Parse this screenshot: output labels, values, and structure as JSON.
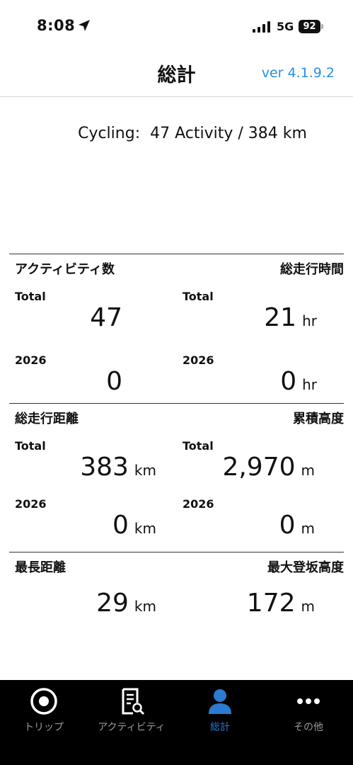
{
  "status_bar": {
    "time": "8:08",
    "network": "5G",
    "battery": "92"
  },
  "header": {
    "title": "総計",
    "version": "ver 4.1.9.2"
  },
  "summary": "Cycling:  47 Activity / 384 km",
  "sections": [
    {
      "left_title": "アクティビティ数",
      "right_title": "総走行時間",
      "rows": [
        {
          "left": {
            "label": "Total",
            "value": "47",
            "unit": ""
          },
          "right": {
            "label": "Total",
            "value": "21",
            "unit": "hr"
          }
        },
        {
          "left": {
            "label": "2026",
            "value": "0",
            "unit": ""
          },
          "right": {
            "label": "2026",
            "value": "0",
            "unit": "hr"
          }
        }
      ]
    },
    {
      "left_title": "総走行距離",
      "right_title": "累積高度",
      "rows": [
        {
          "left": {
            "label": "Total",
            "value": "383",
            "unit": "km"
          },
          "right": {
            "label": "Total",
            "value": "2,970",
            "unit": "m"
          }
        },
        {
          "left": {
            "label": "2026",
            "value": "0",
            "unit": "km"
          },
          "right": {
            "label": "2026",
            "value": "0",
            "unit": "m"
          }
        }
      ]
    },
    {
      "left_title": "最長距離",
      "right_title": "最大登坂高度",
      "rows": [
        {
          "left": {
            "label": "",
            "value": "29",
            "unit": "km"
          },
          "right": {
            "label": "",
            "value": "172",
            "unit": "m"
          }
        }
      ]
    }
  ],
  "tabs": [
    {
      "label": "トリップ",
      "icon": "record-circle-icon",
      "active": false
    },
    {
      "label": "アクティビティ",
      "icon": "document-search-icon",
      "active": false
    },
    {
      "label": "総計",
      "icon": "person-icon",
      "active": true
    },
    {
      "label": "その他",
      "icon": "more-dots-icon",
      "active": false
    }
  ],
  "colors": {
    "accent": "#2b8ee0",
    "tab_active": "#2b7bd0",
    "tab_inactive": "#9a9a9a",
    "tabbar_bg": "#000000"
  }
}
